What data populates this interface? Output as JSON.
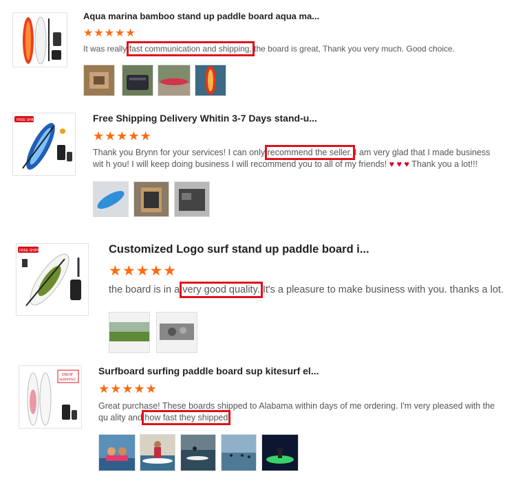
{
  "reviews": [
    {
      "title": "Aqua marina bamboo stand up paddle board aqua ma...",
      "stars": "★★★★★",
      "text_before": "It was really ",
      "highlight": "fast communication and shipping,",
      "text_after": " the board is great, Thank you very much. Good choice.",
      "photo_count": 4
    },
    {
      "title": "Free Shipping Delivery Whitin 3-7 Days stand-u...",
      "stars": "★★★★★",
      "text_before": "Thank you Brynn for your services! I can only ",
      "highlight": "recommend the seller.",
      "text_after": " I am very glad that I made business wit h you! I will keep doing business I will recommend you to all of my friends!",
      "hearts": "♥ ♥ ♥",
      "text_end": "Thank you a lot!!!",
      "badge": "FREE SHIPPING",
      "photo_count": 3
    },
    {
      "title": "Customized Logo surf stand up paddle board i...",
      "stars": "★★★★★",
      "text_before": "the board is in a ",
      "highlight": "very good quality.",
      "text_after": " It's a pleasure to make business with you. thanks a lot.",
      "badge": "FREE SHIPPING",
      "photo_count": 2
    },
    {
      "title": "Surfboard surfing paddle board sup kitesurf el...",
      "stars": "★★★★★",
      "text_before": "Great purchase! These boards shipped to Alabama within days of me ordering. I'm very pleased with the qu ality and ",
      "highlight": "how fast they shipped",
      "text_after": "",
      "badge_line1": "DROP",
      "badge_line2": "SHIPPING",
      "photo_count": 5
    }
  ],
  "colors": {
    "star": "#ff6a13",
    "highlight_box": "#e0101a",
    "heart": "#d6001c"
  }
}
